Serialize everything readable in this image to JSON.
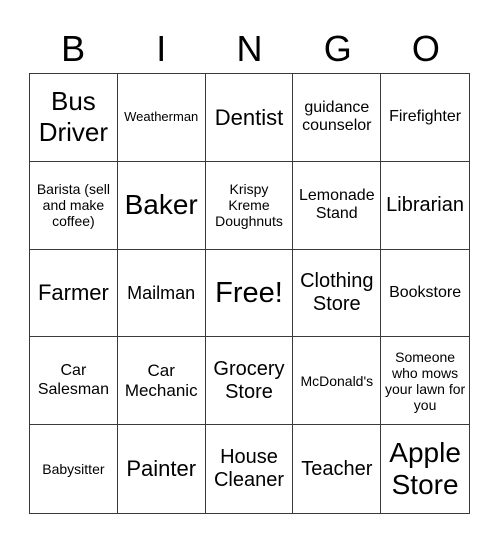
{
  "header": [
    "B",
    "I",
    "N",
    "G",
    "O"
  ],
  "cells": [
    "Bus Driver",
    "Weatherman",
    "Dentist",
    "guidance counselor",
    "Firefighter",
    "Barista (sell and make coffee)",
    "Baker",
    "Krispy Kreme Doughnuts",
    "Lemonade Stand",
    "Librarian",
    "Farmer",
    "Mailman",
    "Free!",
    "Clothing Store",
    "Bookstore",
    "Car Salesman",
    "Car Mechanic",
    "Grocery Store",
    "McDonald's",
    "Someone who mows your lawn for you",
    "Babysitter",
    "Painter",
    "House Cleaner",
    "Teacher",
    "Apple Store"
  ]
}
